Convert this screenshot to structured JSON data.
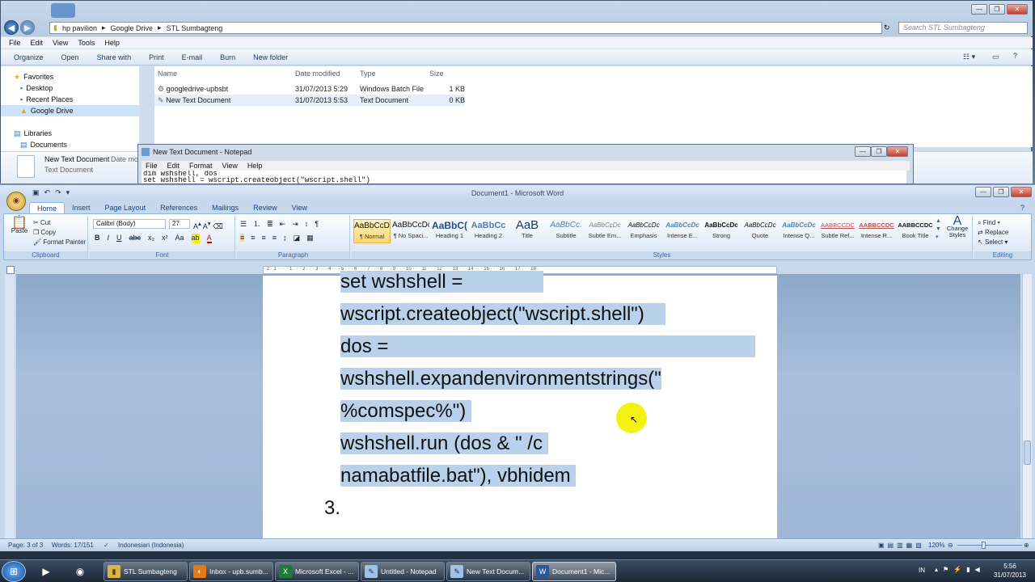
{
  "explorer": {
    "breadcrumb": [
      "hp pavilion",
      "Google Drive",
      "STL Sumbagteng"
    ],
    "search_placeholder": "Search STL Sumbagteng",
    "menu": [
      "File",
      "Edit",
      "View",
      "Tools",
      "Help"
    ],
    "commands": [
      "Organize",
      "Open",
      "Share with",
      "Print",
      "E-mail",
      "Burn",
      "New folder"
    ],
    "nav": {
      "favorites_label": "Favorites",
      "favorites": [
        "Desktop",
        "Recent Places",
        "Google Drive"
      ],
      "libraries_label": "Libraries",
      "libraries": [
        "Documents"
      ]
    },
    "columns": [
      "Name",
      "Date modified",
      "Type",
      "Size"
    ],
    "files": [
      {
        "name": "googledrive-upbsbt",
        "date": "31/07/2013 5:29",
        "type": "Windows Batch File",
        "size": "1 KB"
      },
      {
        "name": "New Text Document",
        "date": "31/07/2013 5:53",
        "type": "Text Document",
        "size": "0 KB"
      }
    ],
    "details": {
      "name": "New Text Document",
      "date_label": "Date mo",
      "type": "Text Document"
    }
  },
  "notepad": {
    "title": "New Text Document - Notepad",
    "menu": [
      "File",
      "Edit",
      "Format",
      "View",
      "Help"
    ],
    "lines": [
      "dim wshshell, dos",
      "set wshshell = wscript.createobject(\"wscript.shell\")"
    ]
  },
  "word": {
    "title": "Document1 - Microsoft Word",
    "tabs": [
      "Home",
      "Insert",
      "Page Layout",
      "References",
      "Mailings",
      "Review",
      "View"
    ],
    "clipboard": {
      "paste": "Paste",
      "cut": "Cut",
      "copy": "Copy",
      "format_painter": "Format Painter",
      "label": "Clipboard"
    },
    "font": {
      "name": "Calibri (Body)",
      "size": "27",
      "label": "Font"
    },
    "paragraph_label": "Paragraph",
    "styles": [
      {
        "preview": "AaBbCcDc",
        "name": "¶ Normal"
      },
      {
        "preview": "AaBbCcDc",
        "name": "¶ No Spaci..."
      },
      {
        "preview": "AaBbC(",
        "name": "Heading 1"
      },
      {
        "preview": "AaBbCc",
        "name": "Heading 2"
      },
      {
        "preview": "AaB",
        "name": "Title"
      },
      {
        "preview": "AaBbCc.",
        "name": "Subtitle"
      },
      {
        "preview": "AaBbCcDc",
        "name": "Subtle Em..."
      },
      {
        "preview": "AaBbCcDc",
        "name": "Emphasis"
      },
      {
        "preview": "AaBbCcDc",
        "name": "Intense E..."
      },
      {
        "preview": "AaBbCcDc",
        "name": "Strong"
      },
      {
        "preview": "AaBbCcDc",
        "name": "Quote"
      },
      {
        "preview": "AaBbCcDc",
        "name": "Intense Q..."
      },
      {
        "preview": "AABBCCDC",
        "name": "Subtle Ref..."
      },
      {
        "preview": "AABBCCDC",
        "name": "Intense R..."
      },
      {
        "preview": "AABBCCDC",
        "name": "Book Title"
      }
    ],
    "styles_label": "Styles",
    "change_styles": "Change Styles",
    "editing": {
      "find": "Find",
      "replace": "Replace",
      "select": "Select",
      "label": "Editing"
    },
    "ruler": "· 2 · 1 · · · · 1 · · · 2 · · · 3 · · · 4 · · · 5 · · · 6 · · · 7 · · · 8 · · · 9 · · · 10 · · · 11 · · · 12 · · · 13 · · · 14 · · · 15 · · · 16 · · · 17 · · · 18 ·",
    "doc_lines": [
      "set wshshell =",
      "wscript.createobject(\"wscript.shell\")",
      "dos =",
      "wshshell.expandenvironmentstrings(\"",
      "%comspec%\")",
      "wshshell.run (dos & \" /c",
      "namabatfile.bat\"), vbhidem"
    ],
    "list_number": "3.",
    "status": {
      "page": "Page: 3 of 3",
      "words": "Words: 17/151",
      "language": "Indonesian (Indonesia)",
      "zoom": "120%"
    }
  },
  "taskbar": {
    "tasks": [
      {
        "label": "STL Sumbagteng",
        "icon": "folder-icon"
      },
      {
        "label": "Inbox - upb.sumb...",
        "icon": "firefox-icon"
      },
      {
        "label": "Microsoft Excel - ...",
        "icon": "excel-icon"
      },
      {
        "label": "Untitled - Notepad",
        "icon": "notepad-icon"
      },
      {
        "label": "New Text Docum...",
        "icon": "notepad-icon"
      },
      {
        "label": "Document1 - Mic...",
        "icon": "word-icon"
      }
    ],
    "tray": {
      "lang": "IN",
      "time": "5:56",
      "date": "31/07/2013"
    }
  },
  "colors": {
    "selection": "#b9d1ea",
    "cursor_highlight": "#f4f000",
    "taskbar": "#1b2736"
  }
}
